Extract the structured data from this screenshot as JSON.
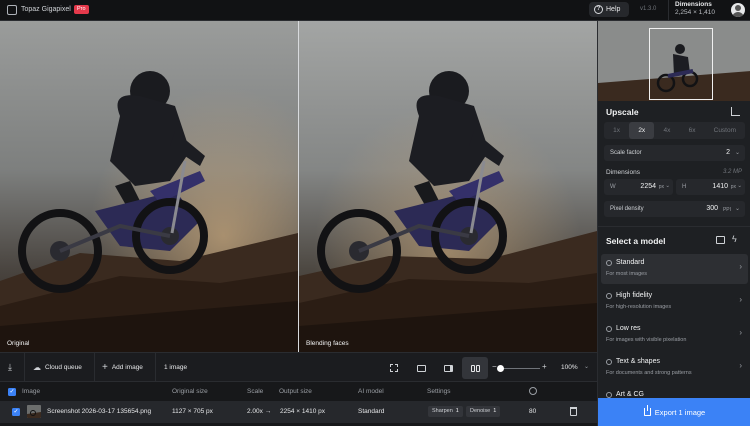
{
  "app": {
    "title": "Topaz Gigapixel",
    "badge": "Pro",
    "version": "v1.3.0"
  },
  "header": {
    "help_label": "Help",
    "dimensions_title": "Dimensions",
    "dimensions_value": "2,254 × 1,410"
  },
  "preview": {
    "left_label": "Original",
    "right_label": "Blending faces"
  },
  "upscale": {
    "title": "Upscale",
    "scale_options": [
      "1x",
      "2x",
      "4x",
      "6x",
      "Custom"
    ],
    "selected_scale": "2x",
    "scale_factor_label": "Scale factor",
    "scale_factor_value": "2",
    "dimensions_label": "Dimensions",
    "megapixels": "3.2 MP",
    "width_label": "W",
    "width_value": "2254",
    "width_unit": "px",
    "height_label": "H",
    "height_value": "1410",
    "height_unit": "px",
    "pixel_density_label": "Pixel density",
    "pixel_density_value": "300",
    "pixel_density_unit": "PPI"
  },
  "models": {
    "title": "Select a model",
    "items": [
      {
        "name": "Standard",
        "desc": "For most images"
      },
      {
        "name": "High fidelity",
        "desc": "For high-resolution images"
      },
      {
        "name": "Low res",
        "desc": "For images with visible pixelation"
      },
      {
        "name": "Text & shapes",
        "desc": "For documents and strong patterns"
      },
      {
        "name": "Art & CG",
        "desc": ""
      }
    ]
  },
  "export": {
    "label": "Export 1 image"
  },
  "toolbar": {
    "cloud_queue": "Cloud queue",
    "add_image": "Add image",
    "image_count": "1 image",
    "zoom": "100%",
    "zoom_level": 0.0
  },
  "table": {
    "headers": [
      "Image",
      "Original size",
      "Scale",
      "Output size",
      "AI model",
      "Settings"
    ],
    "rows": [
      {
        "filename": "Screenshot 2026-03-17 135654.png",
        "original_size": "1127 × 705 px",
        "scale": "2.00x →",
        "output_size": "2254 × 1410 px",
        "model": "Standard",
        "sharpen_label": "Sharpen",
        "sharpen_value": "1",
        "denoise_label": "Denoise",
        "denoise_value": "1",
        "score": "80"
      }
    ]
  },
  "colors": {
    "accent": "#3b82f6",
    "badge": "#e5394b",
    "background": "#17181a",
    "panel": "#1e2023"
  }
}
